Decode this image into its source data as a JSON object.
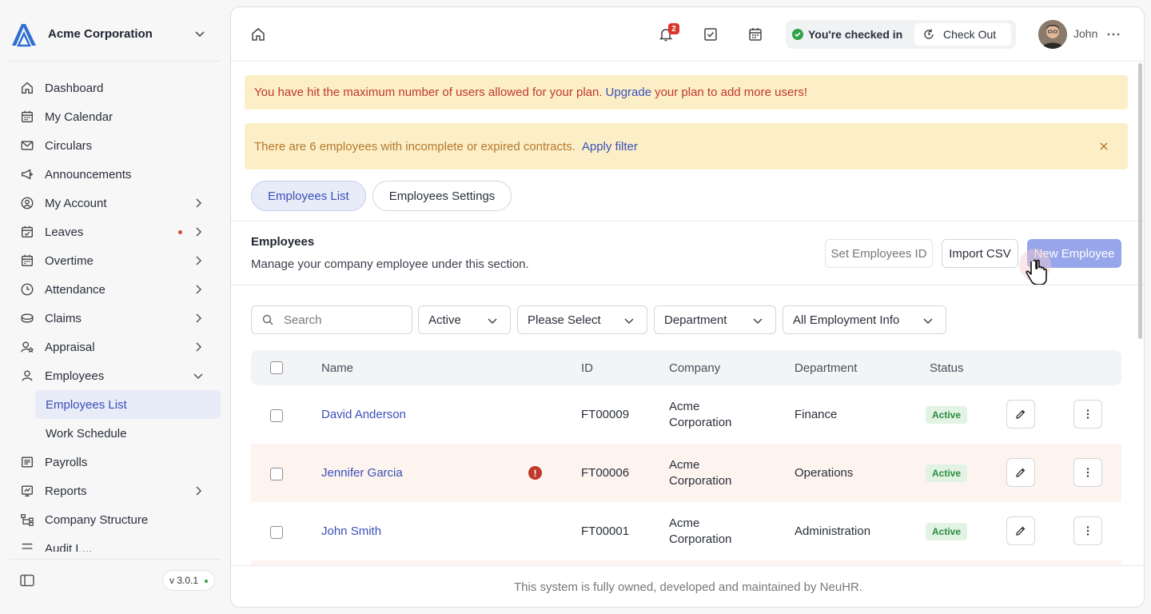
{
  "sidebar": {
    "org_name": "Acme Corporation",
    "items": [
      {
        "label": "Dashboard",
        "icon": "home-icon"
      },
      {
        "label": "My Calendar",
        "icon": "calendar-icon"
      },
      {
        "label": "Circulars",
        "icon": "mail-icon"
      },
      {
        "label": "Announcements",
        "icon": "megaphone-icon"
      },
      {
        "label": "My Account",
        "icon": "user-circle-icon"
      },
      {
        "label": "Leaves",
        "icon": "calendar-check-icon"
      },
      {
        "label": "Overtime",
        "icon": "calendar-clock-icon"
      },
      {
        "label": "Attendance",
        "icon": "clock-icon"
      },
      {
        "label": "Claims",
        "icon": "coins-icon"
      },
      {
        "label": "Appraisal",
        "icon": "user-star-icon"
      },
      {
        "label": "Employees",
        "icon": "user-icon"
      },
      {
        "label": "Payrolls",
        "icon": "receipt-icon"
      },
      {
        "label": "Reports",
        "icon": "report-icon"
      },
      {
        "label": "Company Structure",
        "icon": "org-chart-icon"
      },
      {
        "label": "Audit L...",
        "icon": "audit-icon"
      }
    ],
    "employees_sub": [
      {
        "label": "Employees List"
      },
      {
        "label": "Work Schedule"
      }
    ],
    "version": "v 3.0.1"
  },
  "topbar": {
    "notification_count": "2",
    "check_status": "You're checked in",
    "checkout_label": "Check Out",
    "user_name": "John"
  },
  "alerts": {
    "plan_text": "You have hit the maximum number of users allowed for your plan.",
    "plan_link": "Upgrade",
    "plan_text_after": "your plan to add more users!",
    "contract_text": "There are 6 employees with incomplete or expired contracts.",
    "contract_link": "Apply filter"
  },
  "tabs": [
    {
      "label": "Employees List",
      "active": true
    },
    {
      "label": "Employees Settings",
      "active": false
    }
  ],
  "section": {
    "title": "Employees",
    "description": "Manage your company employee under this section.",
    "btn_set_id": "Set Employees ID",
    "btn_import": "Import CSV",
    "btn_new": "New Employee"
  },
  "filters": {
    "search_placeholder": "Search",
    "status": "Active",
    "select": "Please Select",
    "department": "Department",
    "employment": "All Employment Info"
  },
  "table": {
    "columns": {
      "name": "Name",
      "id": "ID",
      "company": "Company",
      "department": "Department",
      "status": "Status"
    },
    "rows": [
      {
        "name": "David Anderson",
        "id": "FT00009",
        "company_line1": "Acme",
        "company_line2": "Corporation",
        "department": "Finance",
        "status": "Active"
      },
      {
        "name": "Jennifer Garcia",
        "id": "FT00006",
        "company_line1": "Acme",
        "company_line2": "Corporation",
        "department": "Operations",
        "status": "Active",
        "warning": "!"
      },
      {
        "name": "John Smith",
        "id": "FT00001",
        "company_line1": "Acme",
        "company_line2": "Corporation",
        "department": "Administration",
        "status": "Active"
      }
    ]
  },
  "footer": "This system is fully owned, developed and maintained by NeuHR.",
  "colors": {
    "accent": "#3a50b8",
    "primary_button": "#97a6ea",
    "alert_bg": "#fcefc7",
    "active_green": "#2a8a3e"
  }
}
